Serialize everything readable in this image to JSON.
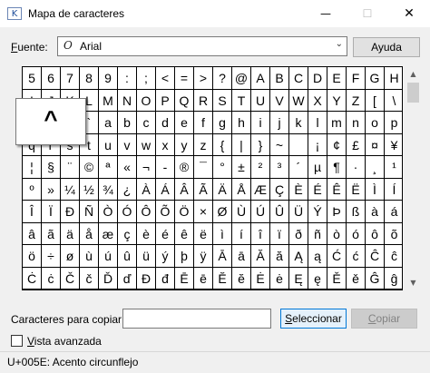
{
  "window": {
    "title": "Mapa de caracteres",
    "icon": "charmap-icon",
    "minimize_glyph": "—",
    "maximize_glyph": "☐",
    "close_glyph": "✕"
  },
  "font_row": {
    "label_accel": "F",
    "label_rest": "uente:",
    "font_icon_glyph": "O",
    "selected_font": "Arial",
    "dropdown_glyph": "⌄",
    "help_label": "Ayuda"
  },
  "grid": {
    "columns": 20,
    "rows": 10,
    "selected_char": "^",
    "characters": [
      "5",
      "6",
      "7",
      "8",
      "9",
      ":",
      ";",
      "<",
      "=",
      ">",
      "?",
      "@",
      "A",
      "B",
      "C",
      "D",
      "E",
      "F",
      "G",
      "H",
      "I",
      "J",
      "K",
      "L",
      "M",
      "N",
      "O",
      "P",
      "Q",
      "R",
      "S",
      "T",
      "U",
      "V",
      "W",
      "X",
      "Y",
      "Z",
      "[",
      "\\",
      "]",
      "^",
      "_",
      "`",
      "a",
      "b",
      "c",
      "d",
      "e",
      "f",
      "g",
      "h",
      "i",
      "j",
      "k",
      "l",
      "m",
      "n",
      "o",
      "p",
      "q",
      "r",
      "s",
      "t",
      "u",
      "v",
      "w",
      "x",
      "y",
      "z",
      "{",
      "|",
      "}",
      "~",
      "",
      "¡",
      "¢",
      "£",
      "¤",
      "¥",
      "¦",
      "§",
      "¨",
      "©",
      "ª",
      "«",
      "¬",
      "-",
      "®",
      "¯",
      "°",
      "±",
      "²",
      "³",
      "´",
      "µ",
      "¶",
      "·",
      "¸",
      "¹",
      "º",
      "»",
      "¼",
      "½",
      "¾",
      "¿",
      "À",
      "Á",
      "Â",
      "Ã",
      "Ä",
      "Å",
      "Æ",
      "Ç",
      "È",
      "É",
      "Ê",
      "Ë",
      "Ì",
      "Í",
      "Î",
      "Ï",
      "Ð",
      "Ñ",
      "Ò",
      "Ó",
      "Ô",
      "Õ",
      "Ö",
      "×",
      "Ø",
      "Ù",
      "Ú",
      "Û",
      "Ü",
      "Ý",
      "Þ",
      "ß",
      "à",
      "á",
      "â",
      "ã",
      "ä",
      "å",
      "æ",
      "ç",
      "è",
      "é",
      "ê",
      "ë",
      "ì",
      "í",
      "î",
      "ï",
      "ð",
      "ñ",
      "ò",
      "ó",
      "ô",
      "õ",
      "ö",
      "÷",
      "ø",
      "ù",
      "ú",
      "û",
      "ü",
      "ý",
      "þ",
      "ÿ",
      "Ā",
      "ā",
      "Ă",
      "ă",
      "Ą",
      "ą",
      "Ć",
      "ć",
      "Ĉ",
      "ĉ",
      "Ċ",
      "ċ",
      "Č",
      "č",
      "Ď",
      "ď",
      "Đ",
      "đ",
      "Ē",
      "ē",
      "Ĕ",
      "ĕ",
      "Ė",
      "ė",
      "Ę",
      "ę",
      "Ě",
      "ě",
      "Ĝ",
      "ĝ"
    ]
  },
  "scrollbar": {
    "up_glyph": "▲",
    "down_glyph": "▼"
  },
  "copy_row": {
    "label": "Caracteres para copiar:",
    "value": "",
    "select_accel": "S",
    "select_rest": "eleccionar",
    "copy_accel": "C",
    "copy_rest": "opiar"
  },
  "advanced": {
    "checked": false,
    "label_accel": "V",
    "label_rest": "ista avanzada"
  },
  "status": {
    "text": "U+005E: Acento circunflejo"
  }
}
